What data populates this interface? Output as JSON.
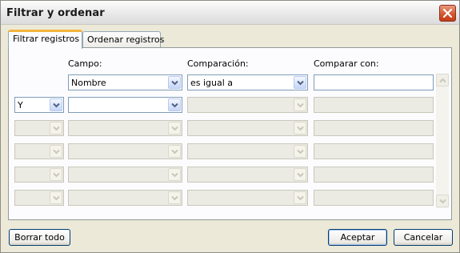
{
  "window": {
    "title": "Filtrar y ordenar"
  },
  "tabs": [
    {
      "label": "Filtrar registros",
      "active": true
    },
    {
      "label": "Ordenar registros",
      "active": false
    }
  ],
  "columns": {
    "field_label": "Campo:",
    "comparison_label": "Comparación:",
    "compare_to_label": "Comparar con:"
  },
  "rows": [
    {
      "operator": "",
      "field": "Nombre",
      "comparison": "es igual a",
      "compare_to": "",
      "enabled": true
    },
    {
      "operator": "Y",
      "field": "",
      "comparison": "",
      "compare_to": "",
      "enabled": true
    },
    {
      "operator": "",
      "field": "",
      "comparison": "",
      "compare_to": "",
      "enabled": false
    },
    {
      "operator": "",
      "field": "",
      "comparison": "",
      "compare_to": "",
      "enabled": false
    },
    {
      "operator": "",
      "field": "",
      "comparison": "",
      "compare_to": "",
      "enabled": false
    },
    {
      "operator": "",
      "field": "",
      "comparison": "",
      "compare_to": "",
      "enabled": false
    }
  ],
  "buttons": {
    "clear_all": "Borrar todo",
    "accept": "Aceptar",
    "cancel": "Cancelar"
  },
  "colors": {
    "accent_tab": "#f4b43c",
    "close_button": "#d1522c",
    "field_border": "#7f9db9",
    "dialog_bg": "#ece9d8"
  },
  "icons": [
    "close-icon",
    "chevron-down-icon",
    "scroll-up-icon",
    "scroll-down-icon"
  ]
}
